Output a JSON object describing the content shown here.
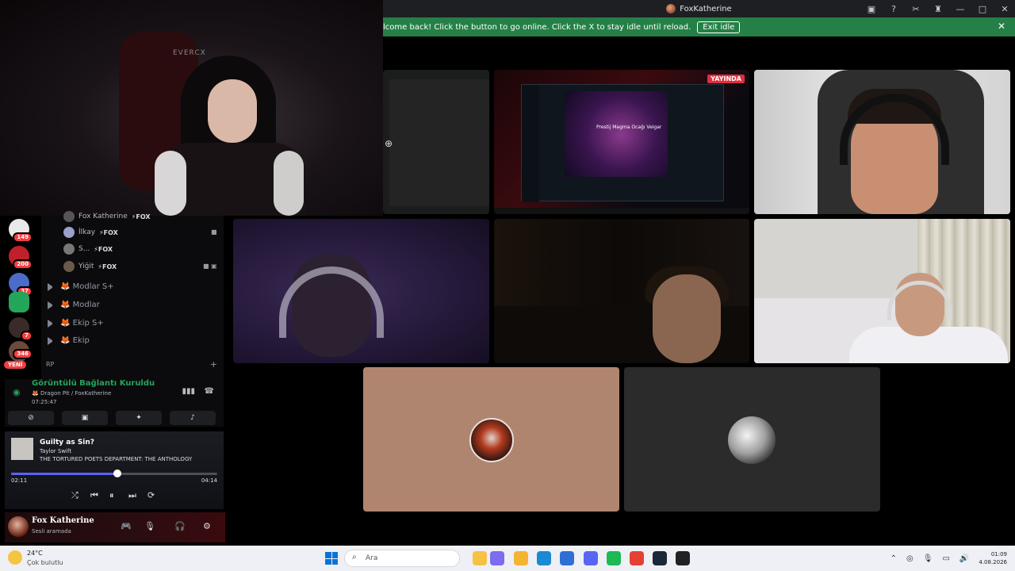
{
  "window": {
    "title": "FoxKatherine",
    "buttons": [
      "inbox-icon",
      "help-icon",
      "tools-icon",
      "gift-icon",
      "—",
      "□",
      "✕"
    ]
  },
  "banner": {
    "message": "lcome back! Click the button to go online. Click the X to stay idle until reload.",
    "exit_label": "Exit idle",
    "close": "✕"
  },
  "stream": {
    "live_label": "YAYINDA",
    "art_label": "Prestij Magma Ocağı Veigar"
  },
  "cams": {
    "fox_logo": "EVERCX"
  },
  "servers": [
    {
      "badge": "149",
      "color": "#e9e9e9"
    },
    {
      "badge": "200",
      "color": "#c0202a"
    },
    {
      "badge": "37",
      "color": "#4b6cc8"
    },
    {
      "badge": "",
      "color": "#23a55a"
    },
    {
      "badge": "7",
      "color": "#3a2a28"
    },
    {
      "badge": "346",
      "color": "#6a4a3a"
    }
  ],
  "servers_new": "YENİ",
  "members": [
    {
      "name": "Fox Katherine",
      "tag": "⚡FOX"
    },
    {
      "name": "İlkay",
      "tag": "⚡FOX"
    },
    {
      "name": "S...",
      "tag": "⚡FOX"
    },
    {
      "name": "Yiğit",
      "tag": "⚡FOX"
    }
  ],
  "channels": [
    {
      "name": "🦊 Modlar S+"
    },
    {
      "name": "🦊 Modlar"
    },
    {
      "name": "🦊 Ekip S+"
    },
    {
      "name": "🦊 Ekip"
    }
  ],
  "category": "RP",
  "category_add": "+",
  "voice": {
    "title": "Görüntülü Bağlantı Kuruldu",
    "subtitle": "🦊 Dragon Pit / FoxKatherine",
    "elapsed": "07:25:47",
    "buttons": [
      "camera-off-icon",
      "screen-share-icon",
      "activities-icon",
      "soundboard-icon"
    ]
  },
  "music": {
    "song": "Guilty as Sin?",
    "artist": "Taylor Swift",
    "album": "THE TORTURED POETS DEPARTMENT: THE ANTHOLOGY",
    "current": "02:11",
    "total": "04:14",
    "progress": 0.516
  },
  "user": {
    "name": "Fox Katherine",
    "status": "Sesli aramada"
  },
  "taskbar": {
    "temperature": "24°C",
    "weather": "Çok bulutlu",
    "search_placeholder": "Ara",
    "time": "01:09",
    "date": "4.08.2026",
    "apps": [
      {
        "name": "file-explorer",
        "color": "#f6c244"
      },
      {
        "name": "copilot",
        "color": "#7b6cf0"
      },
      {
        "name": "folder",
        "color": "#f3b530"
      },
      {
        "name": "edge",
        "color": "#1a8ad4"
      },
      {
        "name": "store",
        "color": "#2e6fd6"
      },
      {
        "name": "discord",
        "color": "#5865f2"
      },
      {
        "name": "spotify",
        "color": "#1db954"
      },
      {
        "name": "chrome",
        "color": "#e44134"
      },
      {
        "name": "steam",
        "color": "#1b2838"
      },
      {
        "name": "obs",
        "color": "#222222"
      }
    ]
  }
}
